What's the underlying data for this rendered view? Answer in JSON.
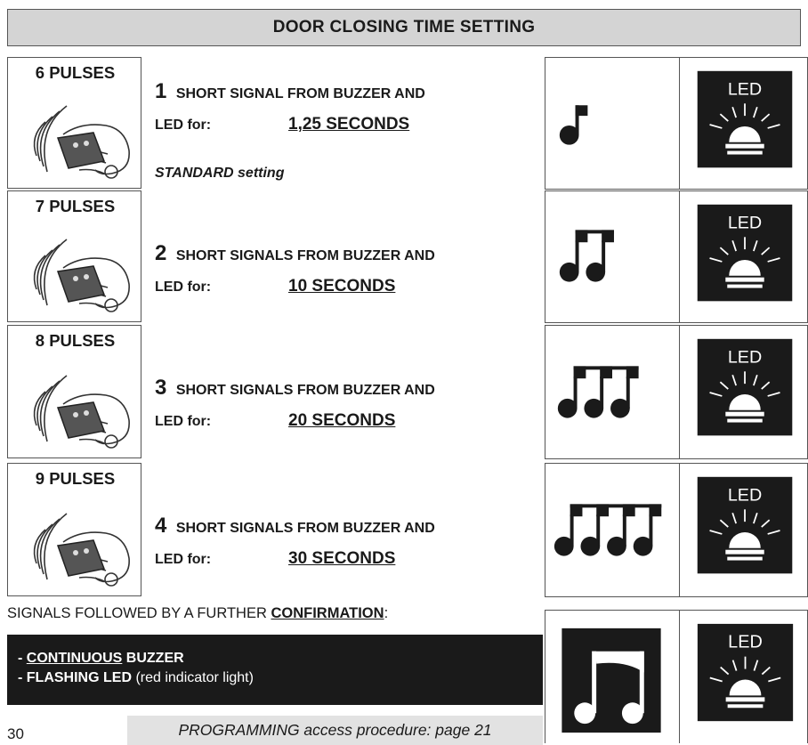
{
  "header": {
    "title": "DOOR CLOSING TIME SETTING"
  },
  "rows": [
    {
      "pulses": "6 PULSES",
      "count": "1",
      "signal": "SHORT SIGNAL FROM BUZZER AND",
      "led_for": "LED for:",
      "time": "1,25 SECONDS",
      "note": "STANDARD setting"
    },
    {
      "pulses": "7 PULSES",
      "count": "2",
      "signal": "SHORT SIGNALS FROM BUZZER AND",
      "led_for": "LED for:",
      "time": "10 SECONDS"
    },
    {
      "pulses": "8 PULSES",
      "count": "3",
      "signal": "SHORT SIGNALS FROM BUZZER AND",
      "led_for": "LED for:",
      "time": "20 SECONDS"
    },
    {
      "pulses": "9 PULSES",
      "count": "4",
      "signal": "SHORT SIGNALS FROM BUZZER AND",
      "led_for": "LED for:",
      "time": "30 SECONDS"
    }
  ],
  "led_label": "LED",
  "confirmation": {
    "prefix": "SIGNALS FOLLOWED BY A FURTHER ",
    "emphasis": "CONFIRMATION",
    "suffix": ":",
    "line1_dash": "- ",
    "line1_u": "CONTINUOUS",
    "line1_rest": " BUZZER",
    "line2_bold": "- FLASHING LED",
    "line2_normal": " (red indicator light)"
  },
  "footer": {
    "note": "PROGRAMMING access procedure: page 21",
    "page": "30"
  }
}
